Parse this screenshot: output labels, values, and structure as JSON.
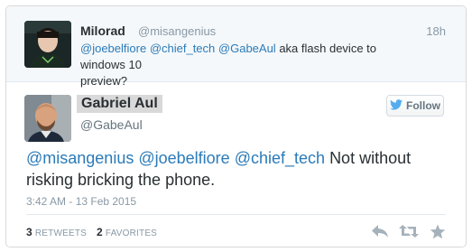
{
  "parent_tweet": {
    "name": "Milorad",
    "handle": "@misangenius",
    "time": "18h",
    "mentions": [
      "@joebelfiore",
      "@chief_tech",
      "@GabeAul"
    ],
    "text_line1": "aka flash device to windows 10",
    "text_line2": "preview?"
  },
  "main_tweet": {
    "name": "Gabriel Aul",
    "handle": "@GabeAul",
    "follow_label": "Follow",
    "mentions": [
      "@misangenius",
      "@joebelfiore",
      "@chief_tech"
    ],
    "text_rest": "Not without",
    "text_line2": "risking bricking the phone.",
    "timestamp": "3:42 AM - 13 Feb 2015"
  },
  "stats": {
    "retweets_count": "3",
    "retweets_label": "RETWEETS",
    "favorites_count": "2",
    "favorites_label": "FAVORITES"
  },
  "icons": [
    "reply-icon",
    "retweet-icon",
    "favorite-icon",
    "twitter-bird-icon"
  ],
  "colors": {
    "link": "#2b7bb9",
    "muted": "#8899a6",
    "text": "#292f33",
    "twitter_blue": "#55acee"
  }
}
